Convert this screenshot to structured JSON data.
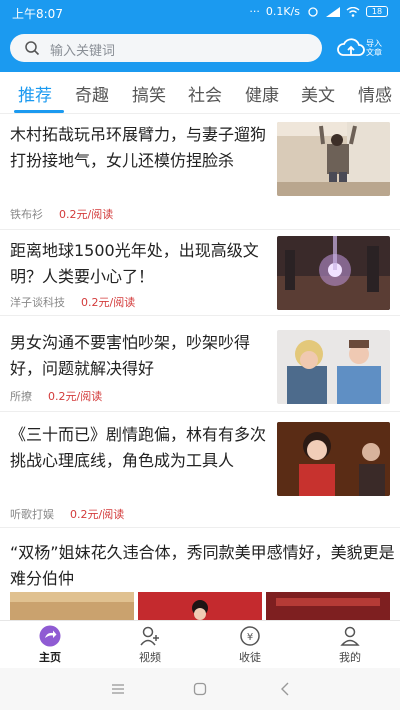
{
  "status_bar": {
    "time": "上午8:07",
    "dots": "···",
    "speed": "0.1K/s",
    "battery": "18"
  },
  "search": {
    "placeholder": "输入关键词",
    "icon": "search-icon"
  },
  "upload": {
    "label": "导入文章",
    "icon": "cloud-upload-icon"
  },
  "tabs": [
    {
      "label": "推荐",
      "active": true
    },
    {
      "label": "奇趣"
    },
    {
      "label": "搞笑"
    },
    {
      "label": "社会"
    },
    {
      "label": "健康"
    },
    {
      "label": "美文"
    },
    {
      "label": "情感"
    }
  ],
  "feed": [
    {
      "title": "木村拓哉玩吊环展臂力，与妻子遛狗打扮接地气，女儿还模仿捏脸杀",
      "source": "铁布衫",
      "reward": "0.2元/阅读"
    },
    {
      "title": "距离地球1500光年处，出现高级文明？人类要小心了！",
      "source": "洋子谈科技",
      "reward": "0.2元/阅读"
    },
    {
      "title": "男女沟通不要害怕吵架，吵架吵得好，问题就解决得好",
      "source": "所撩",
      "reward": "0.2元/阅读"
    },
    {
      "title": "《三十而已》剧情跑偏，林有有多次挑战心理底线，角色成为工具人",
      "source": "听歌打娱",
      "reward": "0.2元/阅读"
    },
    {
      "title": "“双杨”姐妹花久违合体，秀同款美甲感情好，美貌更是难分伯仲"
    }
  ],
  "bottom_nav": [
    {
      "label": "主页",
      "icon": "home-icon",
      "active": true
    },
    {
      "label": "视频",
      "icon": "user-add-icon"
    },
    {
      "label": "收徒",
      "icon": "coin-icon"
    },
    {
      "label": "我的",
      "icon": "profile-icon"
    }
  ],
  "colors": {
    "accent": "#1b9af0",
    "price": "#d33b3b"
  }
}
